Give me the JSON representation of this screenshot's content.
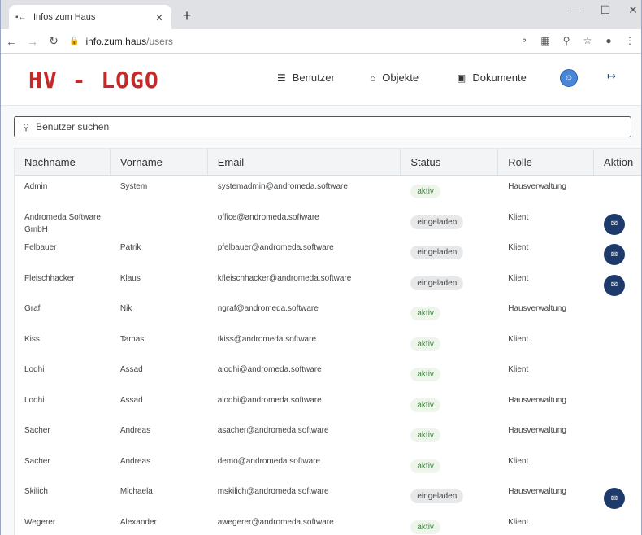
{
  "browser": {
    "tab_title": "Infos zum Haus",
    "url_host": "info.zum.haus",
    "url_path": "/users"
  },
  "header": {
    "logo": "HV - LOGO",
    "nav": [
      {
        "label": "Benutzer",
        "icon": "database-icon"
      },
      {
        "label": "Objekte",
        "icon": "home-icon"
      },
      {
        "label": "Dokumente",
        "icon": "archive-icon"
      }
    ]
  },
  "search": {
    "placeholder": "Benutzer suchen"
  },
  "table": {
    "columns": [
      "Nachname",
      "Vorname",
      "Email",
      "Status",
      "Rolle",
      "Aktion"
    ],
    "rows": [
      {
        "nachname": "Admin",
        "vorname": "System",
        "email": "systemadmin@andromeda.software",
        "status": "aktiv",
        "rolle": "Hausverwaltung",
        "mail": false
      },
      {
        "nachname": "Andromeda Software GmbH",
        "vorname": "",
        "email": "office@andromeda.software",
        "status": "eingeladen",
        "rolle": "Klient",
        "mail": true
      },
      {
        "nachname": "Felbauer",
        "vorname": "Patrik",
        "email": "pfelbauer@andromeda.software",
        "status": "eingeladen",
        "rolle": "Klient",
        "mail": true
      },
      {
        "nachname": "Fleischhacker",
        "vorname": "Klaus",
        "email": "kfleischhacker@andromeda.software",
        "status": "eingeladen",
        "rolle": "Klient",
        "mail": true
      },
      {
        "nachname": "Graf",
        "vorname": "Nik",
        "email": "ngraf@andromeda.software",
        "status": "aktiv",
        "rolle": "Hausverwaltung",
        "mail": false
      },
      {
        "nachname": "Kiss",
        "vorname": "Tamas",
        "email": "tkiss@andromeda.software",
        "status": "aktiv",
        "rolle": "Klient",
        "mail": false
      },
      {
        "nachname": "Lodhi",
        "vorname": "Assad",
        "email": "alodhi@andromeda.software",
        "status": "aktiv",
        "rolle": "Klient",
        "mail": false
      },
      {
        "nachname": "Lodhi",
        "vorname": "Assad",
        "email": "alodhi@andromeda.software",
        "status": "aktiv",
        "rolle": "Hausverwaltung",
        "mail": false
      },
      {
        "nachname": "Sacher",
        "vorname": "Andreas",
        "email": "asacher@andromeda.software",
        "status": "aktiv",
        "rolle": "Hausverwaltung",
        "mail": false
      },
      {
        "nachname": "Sacher",
        "vorname": "Andreas",
        "email": "demo@andromeda.software",
        "status": "aktiv",
        "rolle": "Klient",
        "mail": false
      },
      {
        "nachname": "Skilich",
        "vorname": "Michaela",
        "email": "mskilich@andromeda.software",
        "status": "eingeladen",
        "rolle": "Hausverwaltung",
        "mail": true
      },
      {
        "nachname": "Wegerer",
        "vorname": "Alexander",
        "email": "awegerer@andromeda.software",
        "status": "aktiv",
        "rolle": "Klient",
        "mail": false
      }
    ]
  },
  "colors": {
    "logo": "#c42a2a",
    "primary": "#1d3a6a",
    "aktiv_text": "#3c8a3c"
  }
}
